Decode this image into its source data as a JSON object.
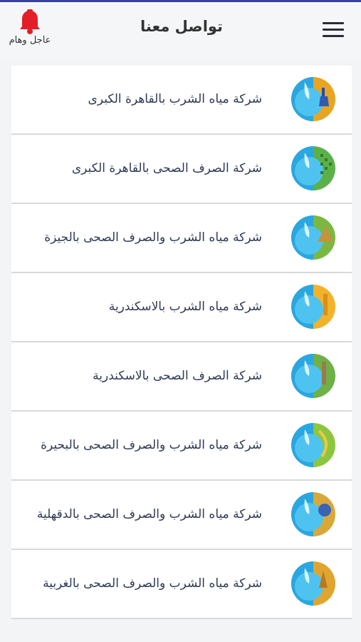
{
  "header": {
    "title": "تواصل معنا",
    "alert_label": "عاجل وهام",
    "accent": "#e41e26",
    "topline": "#3b3fa8"
  },
  "companies": [
    {
      "name": "شركة مياه الشرب بالقاهرة الكبرى",
      "icon": "cairo-water-logo"
    },
    {
      "name": "شركة الصرف الصحى بالقاهرة الكبرى",
      "icon": "cairo-sanitation-logo"
    },
    {
      "name": "شركة مياه الشرب والصرف الصحى بالجيزة",
      "icon": "giza-water-logo"
    },
    {
      "name": "شركة مياه الشرب بالاسكندرية",
      "icon": "alexandria-water-logo"
    },
    {
      "name": "شركة الصرف الصحى بالاسكندرية",
      "icon": "alexandria-sanitation-logo"
    },
    {
      "name": "شركة مياه الشرب والصرف الصحى بالبحيرة",
      "icon": "beheira-water-logo"
    },
    {
      "name": "شركة مياه الشرب والصرف الصحى بالدقهلية",
      "icon": "dakahlia-water-logo"
    },
    {
      "name": "شركة مياه الشرب والصرف الصحى بالغربية",
      "icon": "gharbia-water-logo"
    }
  ]
}
